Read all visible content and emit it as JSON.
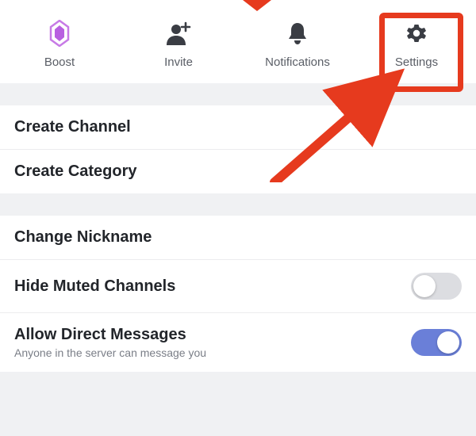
{
  "topActions": {
    "boost": {
      "label": "Boost"
    },
    "invite": {
      "label": "Invite"
    },
    "notifications": {
      "label": "Notifications"
    },
    "settings": {
      "label": "Settings"
    }
  },
  "section1": {
    "createChannel": "Create Channel",
    "createCategory": "Create Category"
  },
  "section2": {
    "changeNickname": "Change Nickname",
    "hideMuted": {
      "label": "Hide Muted Channels",
      "on": false
    },
    "allowDM": {
      "label": "Allow Direct Messages",
      "sub": "Anyone in the server can message you",
      "on": true
    }
  },
  "colors": {
    "highlight": "#e63a1e",
    "toggleOn": "#6a7fd8"
  }
}
